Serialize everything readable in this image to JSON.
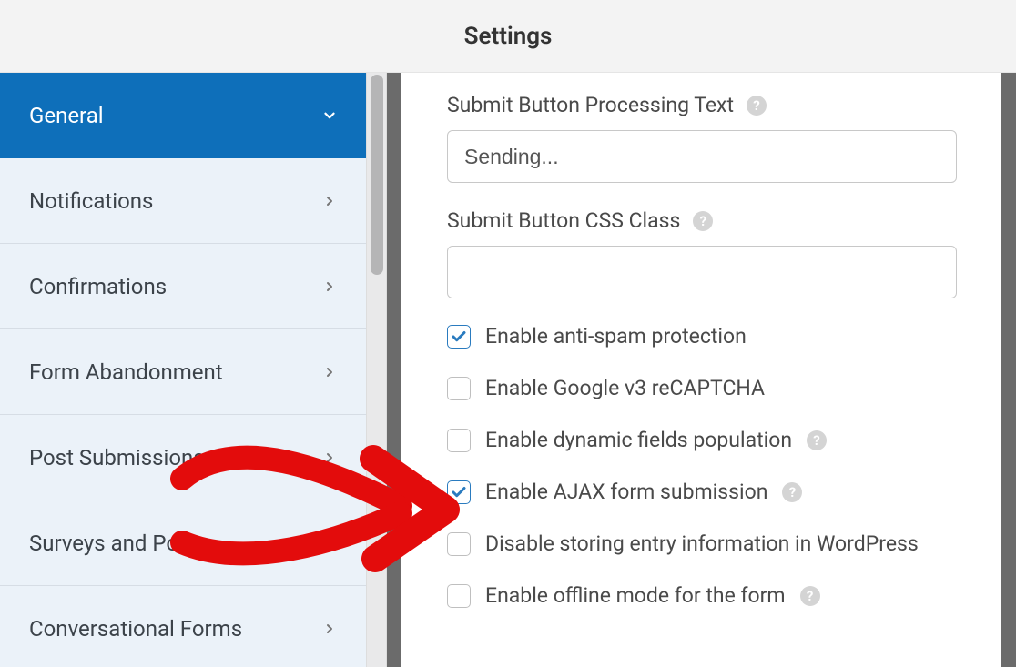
{
  "header": {
    "title": "Settings"
  },
  "sidebar": {
    "items": [
      {
        "label": "General",
        "active": true,
        "expanded": true
      },
      {
        "label": "Notifications",
        "active": false
      },
      {
        "label": "Confirmations",
        "active": false
      },
      {
        "label": "Form Abandonment",
        "active": false
      },
      {
        "label": "Post Submissions",
        "active": false
      },
      {
        "label": "Surveys and Polls",
        "active": false
      },
      {
        "label": "Conversational Forms",
        "active": false
      }
    ]
  },
  "main": {
    "fields": [
      {
        "label": "Submit Button Processing Text",
        "value": "Sending...",
        "help": true
      },
      {
        "label": "Submit Button CSS Class",
        "value": "",
        "help": true
      }
    ],
    "options": [
      {
        "label": "Enable anti-spam protection",
        "checked": true,
        "help": false
      },
      {
        "label": "Enable Google v3 reCAPTCHA",
        "checked": false,
        "help": false
      },
      {
        "label": "Enable dynamic fields population",
        "checked": false,
        "help": true
      },
      {
        "label": "Enable AJAX form submission",
        "checked": true,
        "help": true
      },
      {
        "label": "Disable storing entry information in WordPress",
        "checked": false,
        "help": false
      },
      {
        "label": "Enable offline mode for the form",
        "checked": false,
        "help": true
      }
    ]
  },
  "icons": {
    "help_glyph": "?"
  }
}
